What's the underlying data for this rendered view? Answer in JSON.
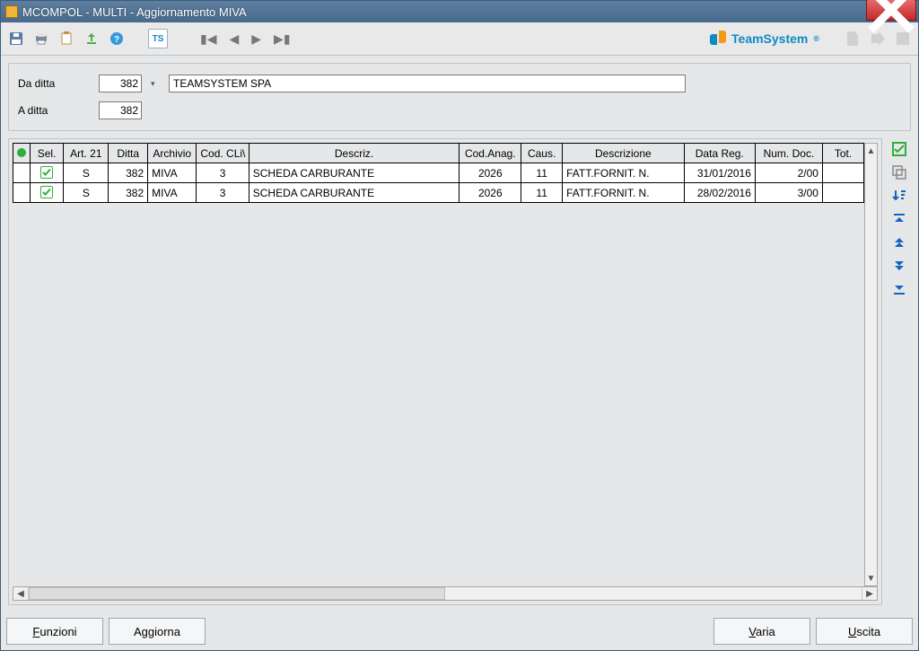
{
  "window": {
    "title": "MCOMPOL  - MULTI -  Aggiornamento MIVA"
  },
  "brand": "TeamSystem",
  "filters": {
    "da_ditta_label": "Da ditta",
    "a_ditta_label": "A ditta",
    "da_ditta_value": "382",
    "a_ditta_value": "382",
    "company_name": "TEAMSYSTEM SPA"
  },
  "columns": {
    "sel": "Sel.",
    "art21": "Art. 21",
    "ditta": "Ditta",
    "archivio": "Archivio",
    "codcli": "Cod. CLi\\",
    "descriz": "Descriz.",
    "codanag": "Cod.Anag.",
    "caus": "Caus.",
    "descrizione": "Descrizione",
    "datareg": "Data Reg.",
    "numdoc": "Num. Doc.",
    "tot": "Tot."
  },
  "rows": [
    {
      "sel": true,
      "art21": "S",
      "ditta": "382",
      "archivio": "MIVA",
      "codcli": "3",
      "descriz": "SCHEDA CARBURANTE",
      "codanag": "2026",
      "caus": "11",
      "descrizione": "FATT.FORNIT. N.",
      "datareg": "31/01/2016",
      "numdoc": "2/00",
      "tot": ""
    },
    {
      "sel": true,
      "art21": "S",
      "ditta": "382",
      "archivio": "MIVA",
      "codcli": "3",
      "descriz": "SCHEDA CARBURANTE",
      "codanag": "2026",
      "caus": "11",
      "descrizione": "FATT.FORNIT. N.",
      "datareg": "28/02/2016",
      "numdoc": "3/00",
      "tot": ""
    }
  ],
  "footer": {
    "funzioni": "Funzioni",
    "aggiorna": "Aggiorna",
    "varia": "Varia",
    "uscita": "Uscita"
  }
}
